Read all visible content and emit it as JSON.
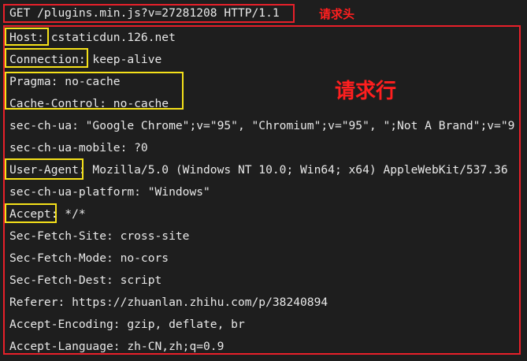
{
  "request_line": "GET /plugins.min.js?v=27281208 HTTP/1.1",
  "annotations": {
    "request_line_label": "请求头",
    "headers_label": "请求行"
  },
  "headers": [
    "Host: cstaticdun.126.net",
    "Connection: keep-alive",
    "Pragma: no-cache",
    "Cache-Control: no-cache",
    "sec-ch-ua: \"Google Chrome\";v=\"95\", \"Chromium\";v=\"95\", \";Not A Brand\";v=\"9",
    "sec-ch-ua-mobile: ?0",
    "User-Agent: Mozilla/5.0 (Windows NT 10.0; Win64; x64) AppleWebKit/537.36",
    "sec-ch-ua-platform: \"Windows\"",
    "Accept: */*",
    "Sec-Fetch-Site: cross-site",
    "Sec-Fetch-Mode: no-cors",
    "Sec-Fetch-Dest: script",
    "Referer: https://zhuanlan.zhihu.com/p/38240894",
    "Accept-Encoding: gzip, deflate, br",
    "Accept-Language: zh-CN,zh;q=0.9"
  ],
  "colors": {
    "background": "#1e1e1e",
    "text": "#e8e8e8",
    "red_box": "#e8202a",
    "yellow_box": "#f5e11a",
    "annotation_text": "#ff1f1f"
  }
}
